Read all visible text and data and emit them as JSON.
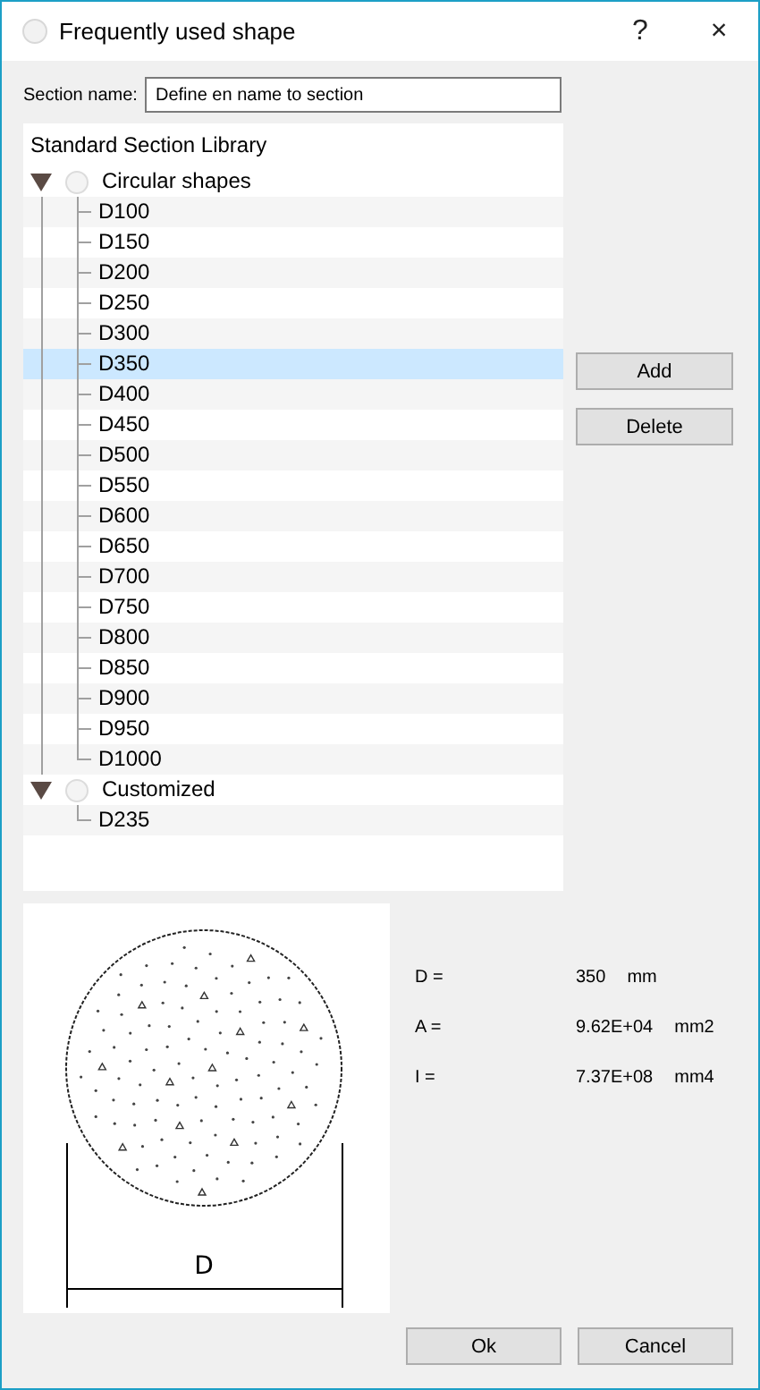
{
  "window": {
    "title": "Frequently used shape",
    "help": "?",
    "close": "×"
  },
  "section_name": {
    "label": "Section name:",
    "value": "Define en name to section"
  },
  "tree": {
    "header": "Standard Section Library",
    "groups": [
      {
        "label": "Circular shapes",
        "expanded": true,
        "children": [
          {
            "label": "D100",
            "selected": false
          },
          {
            "label": "D150",
            "selected": false
          },
          {
            "label": "D200",
            "selected": false
          },
          {
            "label": "D250",
            "selected": false
          },
          {
            "label": "D300",
            "selected": false
          },
          {
            "label": "D350",
            "selected": true
          },
          {
            "label": "D400",
            "selected": false
          },
          {
            "label": "D450",
            "selected": false
          },
          {
            "label": "D500",
            "selected": false
          },
          {
            "label": "D550",
            "selected": false
          },
          {
            "label": "D600",
            "selected": false
          },
          {
            "label": "D650",
            "selected": false
          },
          {
            "label": "D700",
            "selected": false
          },
          {
            "label": "D750",
            "selected": false
          },
          {
            "label": "D800",
            "selected": false
          },
          {
            "label": "D850",
            "selected": false
          },
          {
            "label": "D900",
            "selected": false
          },
          {
            "label": "D950",
            "selected": false
          },
          {
            "label": "D1000",
            "selected": false
          }
        ]
      },
      {
        "label": "Customized",
        "expanded": true,
        "children": [
          {
            "label": "D235",
            "selected": false
          }
        ]
      }
    ]
  },
  "side_buttons": [
    "Add",
    "Delete"
  ],
  "preview": {
    "dimension_label": "D"
  },
  "properties": [
    {
      "name": "D =",
      "value": "350",
      "unit": "mm"
    },
    {
      "name": "A =",
      "value": "9.62E+04",
      "unit": "mm2"
    },
    {
      "name": "I =",
      "value": "7.37E+08",
      "unit": "mm4"
    }
  ],
  "footer_buttons": [
    "Ok",
    "Cancel"
  ]
}
